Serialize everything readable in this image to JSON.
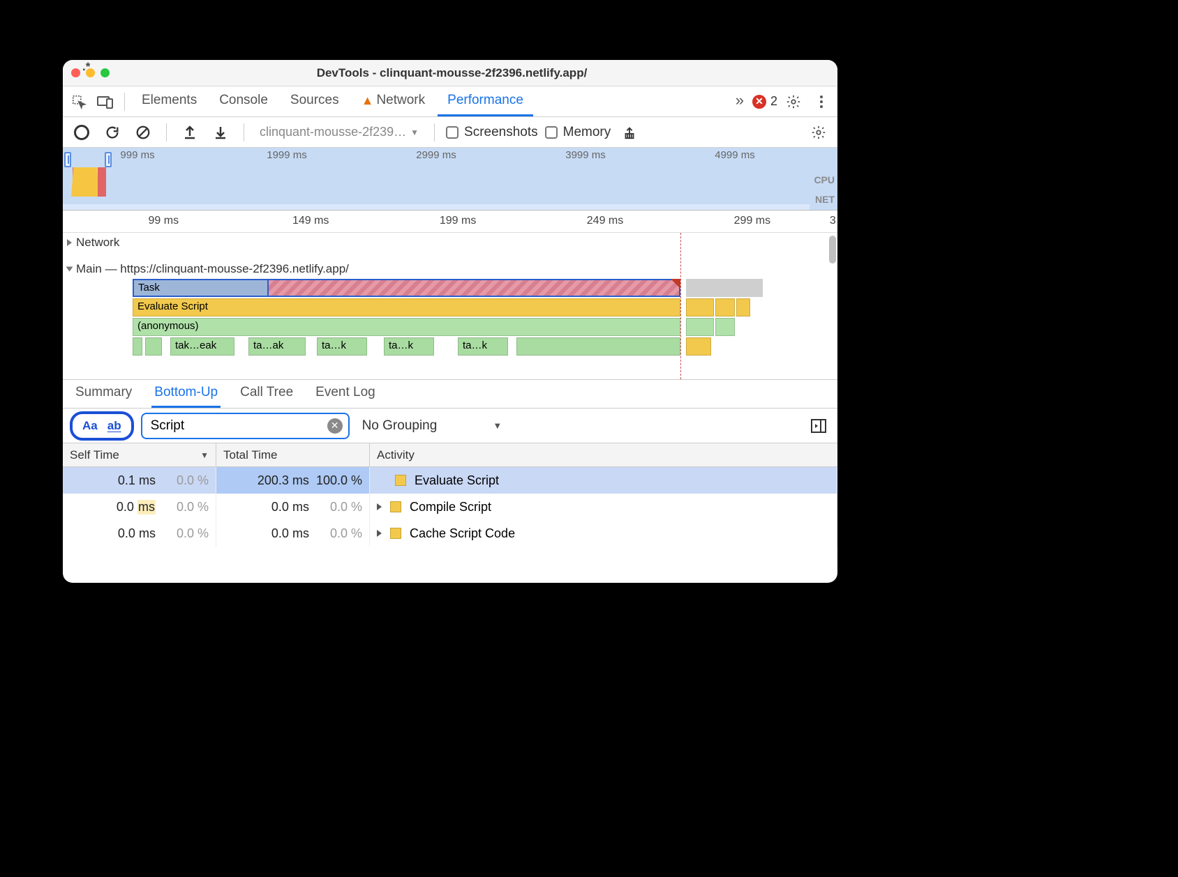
{
  "window": {
    "title": "DevTools - clinquant-mousse-2f2396.netlify.app/"
  },
  "panelTabs": {
    "elements": "Elements",
    "console": "Console",
    "sources": "Sources",
    "network": "Network",
    "performance": "Performance",
    "more": "»",
    "errorCount": "2"
  },
  "perfToolbar": {
    "profileSelect": "clinquant-mousse-2f239…",
    "screenshots": "Screenshots",
    "memory": "Memory"
  },
  "overview": {
    "ticks": [
      "999 ms",
      "1999 ms",
      "2999 ms",
      "3999 ms",
      "4999 ms"
    ],
    "labels": {
      "cpu": "CPU",
      "net": "NET"
    }
  },
  "ruler": {
    "ticks": [
      "99 ms",
      "149 ms",
      "199 ms",
      "249 ms",
      "299 ms",
      "3"
    ]
  },
  "tracks": {
    "network": "Network",
    "mainLabel": "Main — https://clinquant-mousse-2f2396.netlify.app/",
    "task": "Task",
    "evaluate": "Evaluate Script",
    "anonymous": "(anonymous)",
    "leaves": [
      "tak…eak",
      "ta…ak",
      "ta…k",
      "ta…k",
      "ta…k"
    ]
  },
  "detailTabs": {
    "summary": "Summary",
    "bottomUp": "Bottom-Up",
    "callTree": "Call Tree",
    "eventLog": "Event Log"
  },
  "filter": {
    "caseBtn": "Aa",
    "regexBtn": ".*",
    "wholeBtn": "ab",
    "value": "Script",
    "grouping": "No Grouping"
  },
  "table": {
    "headers": {
      "self": "Self Time",
      "total": "Total Time",
      "activity": "Activity"
    },
    "rows": [
      {
        "self_ms": "0.1 ms",
        "self_pct": "0.0 %",
        "total_ms": "200.3 ms",
        "total_pct": "100.0 %",
        "activity": "Evaluate Script",
        "expandable": false,
        "selected": true
      },
      {
        "self_ms": "0.0 ms",
        "self_pct": "0.0 %",
        "total_ms": "0.0 ms",
        "total_pct": "0.0 %",
        "activity": "Compile Script",
        "expandable": true,
        "selected": false,
        "highlight_ms": true
      },
      {
        "self_ms": "0.0 ms",
        "self_pct": "0.0 %",
        "total_ms": "0.0 ms",
        "total_pct": "0.0 %",
        "activity": "Cache Script Code",
        "expandable": true,
        "selected": false
      }
    ]
  }
}
